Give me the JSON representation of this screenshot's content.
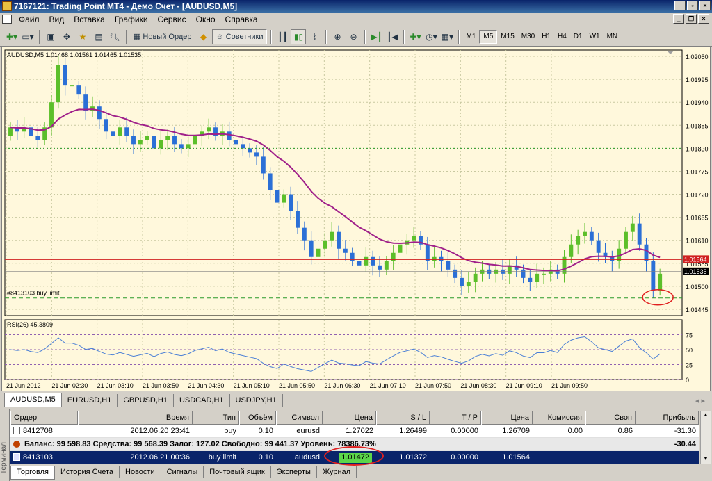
{
  "window": {
    "title": "7167121: Trading Point MT4 - Демо Счет - [AUDUSD,M5]"
  },
  "menu": [
    "Файл",
    "Вид",
    "Вставка",
    "Графики",
    "Сервис",
    "Окно",
    "Справка"
  ],
  "toolbar": {
    "new_order": "Новый Ордер",
    "experts": "Советники"
  },
  "timeframes": [
    "M1",
    "M5",
    "M15",
    "M30",
    "H1",
    "H4",
    "D1",
    "W1",
    "MN"
  ],
  "selected_timeframe": "M5",
  "chart": {
    "header": "AUDUSD,M5  1.01468 1.01561 1.01465 1.01535",
    "pending_label": "#8413103 buy limit",
    "bid_label": "1.01535",
    "red_label": "1.01564",
    "rsi_header": "RSI(26) 45.3809",
    "colors": {
      "bg": "#fff8dc",
      "bull": "#5cbf2a",
      "bear": "#2b6fd6",
      "ma": "#a0208a",
      "rsi": "#4a7fd6",
      "grid": "#c8c8a0"
    }
  },
  "chart_data": {
    "type": "candlestick",
    "symbol": "AUDUSD",
    "timeframe": "M5",
    "price_ticks": [
      "1.02050",
      "1.01995",
      "1.01940",
      "1.01885",
      "1.01830",
      "1.01775",
      "1.01720",
      "1.01665",
      "1.01610",
      "1.01555",
      "1.01500",
      "1.01445"
    ],
    "time_ticks": [
      "21 Jun 2012",
      "21 Jun 02:30",
      "21 Jun 03:10",
      "21 Jun 03:50",
      "21 Jun 04:30",
      "21 Jun 05:10",
      "21 Jun 05:50",
      "21 Jun 06:30",
      "21 Jun 07:10",
      "21 Jun 07:50",
      "21 Jun 08:30",
      "21 Jun 09:10",
      "21 Jun 09:50"
    ],
    "rsi_ticks": [
      "75",
      "50",
      "25",
      "0"
    ],
    "closes": [
      1.0188,
      1.0187,
      1.0188,
      1.0186,
      1.0185,
      1.0188,
      1.0194,
      1.0203,
      1.0198,
      1.0198,
      1.0196,
      1.0192,
      1.0193,
      1.019,
      1.0187,
      1.0186,
      1.0188,
      1.0186,
      1.0184,
      1.0185,
      1.0186,
      1.0183,
      1.0185,
      1.0186,
      1.0184,
      1.0183,
      1.0184,
      1.0186,
      1.0187,
      1.0188,
      1.0186,
      1.0187,
      1.0185,
      1.0184,
      1.0183,
      1.0182,
      1.0181,
      1.0177,
      1.0173,
      1.017,
      1.0172,
      1.0168,
      1.0164,
      1.0161,
      1.0157,
      1.0159,
      1.0161,
      1.0163,
      1.0159,
      1.0158,
      1.0156,
      1.0155,
      1.0157,
      1.0155,
      1.0154,
      1.0156,
      1.0158,
      1.016,
      1.0161,
      1.0162,
      1.016,
      1.0156,
      1.0157,
      1.0156,
      1.0154,
      1.0152,
      1.015,
      1.0151,
      1.0153,
      1.0154,
      1.0153,
      1.0154,
      1.0153,
      1.0155,
      1.0154,
      1.0152,
      1.0151,
      1.0153,
      1.0153,
      1.0154,
      1.0153,
      1.0157,
      1.016,
      1.0162,
      1.0163,
      1.0161,
      1.0158,
      1.0157,
      1.0156,
      1.0159,
      1.0163,
      1.0165,
      1.016,
      1.0156,
      1.0149,
      1.0153
    ],
    "ma_period_label": "",
    "horizontal_lines": {
      "red": 1.01564,
      "bid": 1.01535,
      "pending": 1.01472
    }
  },
  "symbol_tabs": [
    "AUDUSD,M5",
    "EURUSD,H1",
    "GBPUSD,H1",
    "USDCAD,H1",
    "USDJPY,H1"
  ],
  "terminal": {
    "side_label": "Терминал",
    "columns": [
      "Ордер",
      "Время",
      "Тип",
      "Объём",
      "Символ",
      "Цена",
      "S / L",
      "T / P",
      "Цена",
      "Комиссия",
      "Своп",
      "Прибыль"
    ],
    "rows": [
      [
        "8412708",
        "2012.06.20 23:41",
        "buy",
        "0.10",
        "eurusd",
        "1.27022",
        "1.26499",
        "0.00000",
        "1.26709",
        "0.00",
        "0.86",
        "-31.30"
      ]
    ],
    "balance_line": "Баланс: 99 598.83  Средства: 99 568.39  Залог: 127.02  Свободно: 99 441.37  Уровень: 78386.73%",
    "balance_total": "-30.44",
    "pending_row": [
      "8413103",
      "2012.06.21 00:36",
      "buy limit",
      "0.10",
      "audusd",
      "1.01472",
      "1.01372",
      "0.00000",
      "1.01564",
      "",
      "",
      ""
    ],
    "tabs": [
      "Торговля",
      "История Счета",
      "Новости",
      "Сигналы",
      "Почтовый ящик",
      "Эксперты",
      "Журнал"
    ]
  }
}
